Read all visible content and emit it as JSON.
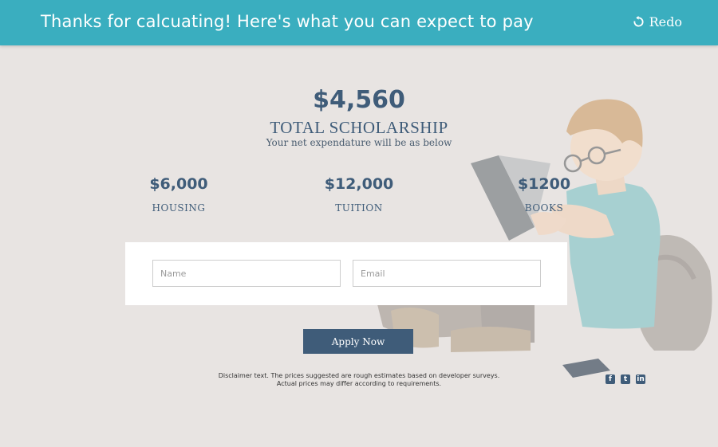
{
  "header": {
    "title": "Thanks for calcuating! Here's what you can expect to pay",
    "redo_label": "Redo"
  },
  "total": {
    "amount": "$4,560",
    "label": "TOTAL SCHOLARSHIP",
    "subtitle": "Your net expendature will be as below"
  },
  "costs": [
    {
      "value": "$6,000",
      "label": "HOUSING"
    },
    {
      "value": "$12,000",
      "label": "TUITION"
    },
    {
      "value": "$1200",
      "label": "BOOKS"
    }
  ],
  "form": {
    "name_placeholder": "Name",
    "email_placeholder": "Email"
  },
  "apply_label": "Apply Now",
  "disclaimer": {
    "line1": "Disclaimer text. The prices suggested are rough estimates  based on developer surveys.",
    "line2": "Actual prices  may differ according to requirements."
  },
  "social": [
    "facebook-icon",
    "twitter-icon",
    "linkedin-icon"
  ],
  "colors": {
    "header": "#3aaebf",
    "accent": "#3f5c79",
    "background": "#e8e4e2"
  }
}
